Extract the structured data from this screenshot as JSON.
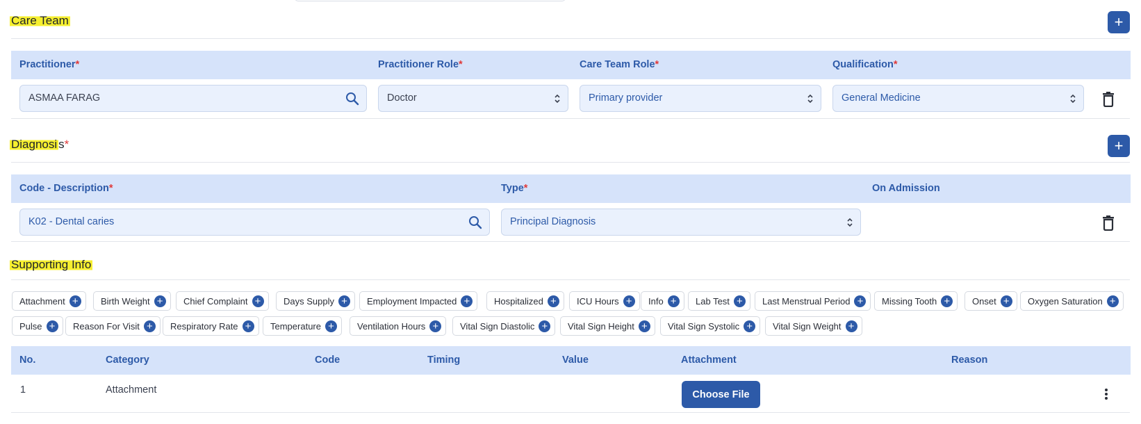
{
  "care_team": {
    "title": "Care Team",
    "add_label": "+",
    "columns": {
      "practitioner": "Practitioner",
      "practitioner_role": "Practitioner Role",
      "care_team_role": "Care Team Role",
      "qualification": "Qualification"
    },
    "required_mark": "*",
    "row": {
      "practitioner": "ASMAA FARAG",
      "practitioner_role": "Doctor",
      "care_team_role": "Primary provider",
      "qualification": "General Medicine"
    }
  },
  "diagnosis": {
    "title_highlight": "Diagnosi",
    "title_rest": "s",
    "required_mark": "*",
    "add_label": "+",
    "columns": {
      "code_description": "Code - Description",
      "type": "Type",
      "on_admission": "On Admission"
    },
    "row": {
      "code_description": "K02 - Dental caries",
      "type": "Principal Diagnosis"
    }
  },
  "supporting_info": {
    "title": "Supporting Info",
    "chips": [
      "Attachment",
      "Birth Weight",
      "Chief Complaint",
      "Days Supply",
      "Employment Impacted",
      "Hospitalized",
      "ICU Hours",
      "Info",
      "Lab Test",
      "Last Menstrual Period",
      "Missing Tooth",
      "Onset",
      "Oxygen Saturation",
      "Pulse",
      "Reason For Visit",
      "Respiratory Rate",
      "Temperature",
      "Ventilation Hours",
      "Vital Sign Diastolic",
      "Vital Sign Height",
      "Vital Sign Systolic",
      "Vital Sign Weight"
    ],
    "columns": {
      "no": "No.",
      "category": "Category",
      "code": "Code",
      "timing": "Timing",
      "value": "Value",
      "attachment": "Attachment",
      "reason": "Reason"
    },
    "rows": [
      {
        "no": "1",
        "category": "Attachment",
        "choose_file": "Choose File"
      }
    ]
  },
  "colors": {
    "accent": "#2d5aa8",
    "header_bg": "#d6e3fa",
    "field_bg": "#eaf1fd",
    "required": "#e03a3a",
    "highlight": "#f6ef2f"
  }
}
